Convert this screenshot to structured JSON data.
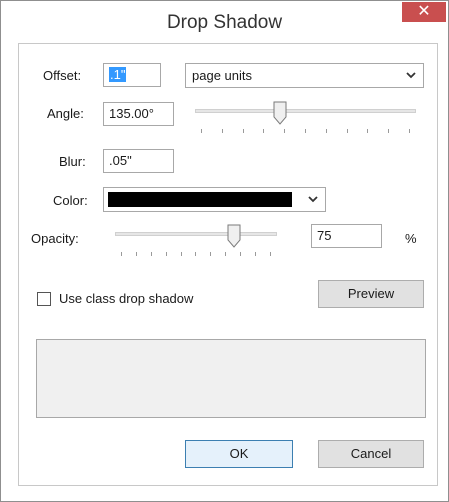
{
  "window": {
    "title": "Drop Shadow",
    "close_glyph": "✕"
  },
  "offset": {
    "label": "Offset:",
    "value": ".1\"",
    "units": "page units"
  },
  "angle": {
    "label": "Angle:",
    "value": "135.00°",
    "slider_fraction": 0.38
  },
  "blur": {
    "label": "Blur:",
    "value": ".05\""
  },
  "color": {
    "label": "Color:",
    "swatch": "#000000"
  },
  "opacity": {
    "label": "Opacity:",
    "value": "75",
    "unit": "%",
    "slider_fraction": 0.75
  },
  "class_shadow": {
    "label": "Use class drop shadow",
    "checked": false
  },
  "buttons": {
    "preview": "Preview",
    "ok": "OK",
    "cancel": "Cancel"
  },
  "icons": {
    "close": "close-icon",
    "chevron": "chevron-down-icon",
    "thumb": "slider-thumb-icon"
  },
  "colors": {
    "close_bg": "#c94f4f",
    "selection": "#3399ff",
    "default_button": "#e5f1fb"
  }
}
